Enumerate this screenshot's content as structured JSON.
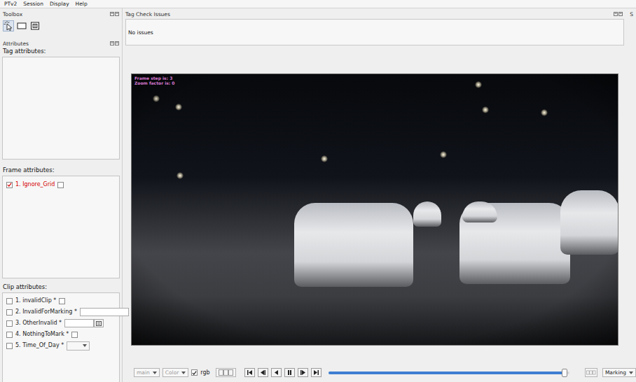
{
  "menu": [
    "PTv2",
    "Session",
    "Display",
    "Help"
  ],
  "toolbox": {
    "title": "Toolbox",
    "tools": [
      {
        "kind": "pointer",
        "selected": true
      },
      {
        "kind": "rectangle",
        "selected": false
      },
      {
        "kind": "delete",
        "selected": false
      }
    ]
  },
  "attributes": {
    "title": "Attributes",
    "tag_label": "Tag attributes:",
    "frame_label": "Frame attributes:",
    "clip_label": "Clip attributes:"
  },
  "frame_attributes": [
    {
      "label": "1. Ignore_Grid",
      "checked": true,
      "flagged": true,
      "value": false
    }
  ],
  "clip_attributes": [
    {
      "label": "1. invalidClip *",
      "checked": false,
      "kind": "checkbox",
      "value": false
    },
    {
      "label": "2. InvalidForMarking *",
      "checked": false,
      "kind": "text",
      "value": ""
    },
    {
      "label": "3. OtherInvalid *",
      "checked": false,
      "kind": "picker",
      "value": ""
    },
    {
      "label": "4. NothingToMark *",
      "checked": false,
      "kind": "checkbox",
      "value": false
    },
    {
      "label": "5. Time_Of_Day *",
      "checked": false,
      "kind": "dropdown",
      "value": ""
    }
  ],
  "tag_check": {
    "title": "Tag Check Issues",
    "text": "No issues"
  },
  "side_dock": {
    "title": "S"
  },
  "video": {
    "overlay": [
      "Frame step is: 3",
      "Zoom factor is: 0"
    ]
  },
  "controls": {
    "view": {
      "text": "main",
      "disabled": true
    },
    "color": {
      "text": "Color",
      "disabled": true
    },
    "rgb": {
      "label": "rgb",
      "checked": true
    },
    "transport": [
      {
        "kind": "first"
      },
      {
        "kind": "step-back"
      },
      {
        "kind": "play-back"
      },
      {
        "kind": "pause"
      },
      {
        "kind": "step-forward"
      },
      {
        "kind": "last"
      }
    ],
    "level": 0.98,
    "mode": {
      "text": "Marking",
      "disabled": false
    }
  }
}
